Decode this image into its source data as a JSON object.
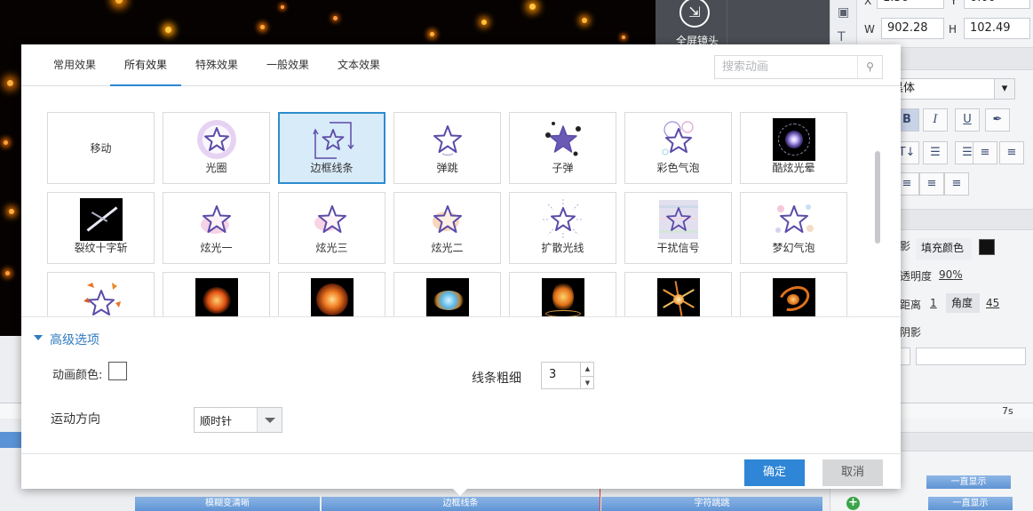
{
  "background": {
    "fullscreen_label": "全屏镜头",
    "props": {
      "x_label": "X",
      "x_value": "1.36",
      "y_label": "Y",
      "y_value": "0.00",
      "w_label": "W",
      "w_value": "902.28",
      "h_label": "H",
      "h_value": "102.49",
      "font_name": "黑体",
      "bold": "B",
      "italic": "I",
      "underline": "U",
      "shadow_label": "影",
      "fill_label": "填充颜色",
      "opacity_label": "透明度",
      "opacity_value": "90%",
      "distance_label": "距离",
      "distance_value": "1",
      "angle_label": "角度",
      "angle_value": "45",
      "blur_label": "阴影"
    },
    "timeline": {
      "tick_7s": "7s",
      "clip_1": "模糊变清晰",
      "clip_2": "边框线条",
      "clip_3": "字符跳跳",
      "badge_1": "一直显示",
      "badge_2": "一直显示"
    }
  },
  "dialog": {
    "tabs": [
      {
        "label": "常用效果"
      },
      {
        "label": "所有效果"
      },
      {
        "label": "特殊效果"
      },
      {
        "label": "一般效果"
      },
      {
        "label": "文本效果"
      }
    ],
    "active_tab": "所有效果",
    "search": {
      "placeholder": "搜索动画",
      "value": ""
    },
    "effects": [
      {
        "label": "移动",
        "icon": "move-icon"
      },
      {
        "label": "光圈",
        "icon": "halo-star-icon"
      },
      {
        "label": "边框线条",
        "icon": "border-line-star-icon",
        "selected": true
      },
      {
        "label": "弹跳",
        "icon": "bounce-star-icon"
      },
      {
        "label": "子弹",
        "icon": "bullet-star-icon"
      },
      {
        "label": "彩色气泡",
        "icon": "color-bubble-star-icon"
      },
      {
        "label": "酷炫光晕",
        "icon": "cool-glow-icon"
      },
      {
        "label": "裂纹十字斩",
        "icon": "crack-slash-icon"
      },
      {
        "label": "炫光一",
        "icon": "glare-one-star-icon"
      },
      {
        "label": "炫光三",
        "icon": "glare-three-star-icon"
      },
      {
        "label": "炫光二",
        "icon": "glare-two-star-icon"
      },
      {
        "label": "扩散光线",
        "icon": "spread-rays-star-icon"
      },
      {
        "label": "干扰信号",
        "icon": "interference-star-icon"
      },
      {
        "label": "梦幻气泡",
        "icon": "dream-bubble-star-icon"
      },
      {
        "label": "",
        "icon": "leaf-star-icon"
      },
      {
        "label": "",
        "icon": "fire-burst-icon"
      },
      {
        "label": "",
        "icon": "explosion-icon"
      },
      {
        "label": "",
        "icon": "ice-burst-icon"
      },
      {
        "label": "",
        "icon": "ground-flame-icon"
      },
      {
        "label": "",
        "icon": "light-streak-icon"
      },
      {
        "label": "",
        "icon": "fire-swirl-icon"
      }
    ],
    "advanced": {
      "title": "高级选项",
      "color_label": "动画颜色:",
      "color_value": "#ffffff",
      "line_width_label": "线条粗细",
      "line_width_value": "3",
      "direction_label": "运动方向",
      "direction_value": "顺时针"
    },
    "ok_label": "确定",
    "cancel_label": "取消",
    "accent_color": "#2f86d6"
  }
}
